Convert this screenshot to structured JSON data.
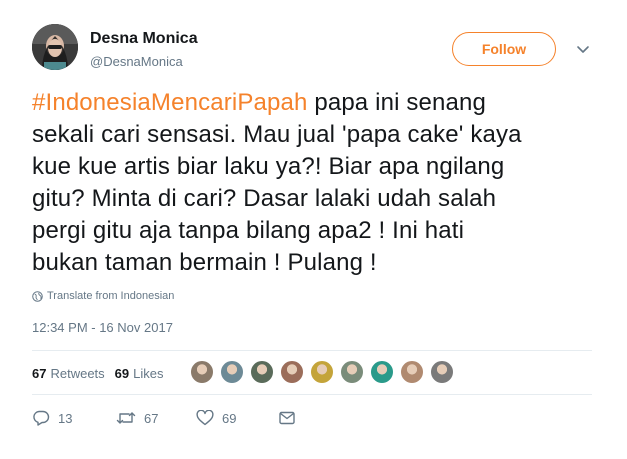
{
  "user": {
    "name": "Desna Monica",
    "handle": "@DesnaMonica"
  },
  "follow_label": "Follow",
  "tweet": {
    "hashtag": "#IndonesiaMencariPapah",
    "line1_rest": " papa ini senang",
    "line2": "sekali cari sensasi. Mau jual 'papa cake' kaya",
    "line3": "kue kue artis biar laku ya?! Biar apa ngilang",
    "line4": "gitu? Minta di cari? Dasar lalaki udah salah",
    "line5": "pergi gitu aja tanpa bilang apa2 ! Ini hati",
    "line6": "bukan taman bermain ! Pulang !"
  },
  "translate_label": "Translate from Indonesian",
  "timestamp": "12:34 PM - 16 Nov 2017",
  "stats": {
    "retweets_count": "67",
    "retweets_label": "Retweets",
    "likes_count": "69",
    "likes_label": "Likes"
  },
  "liker_colors": [
    "#8a7a6a",
    "#6d8a96",
    "#5a6b5a",
    "#9b6d5a",
    "#c4a43a",
    "#7a8c7a",
    "#2a9a8a",
    "#b08a70",
    "#7a7a7a"
  ],
  "actions": {
    "replies": "13",
    "retweets": "67",
    "likes": "69"
  },
  "colors": {
    "accent": "#f5822b",
    "muted": "#657786",
    "text": "#14171a"
  }
}
